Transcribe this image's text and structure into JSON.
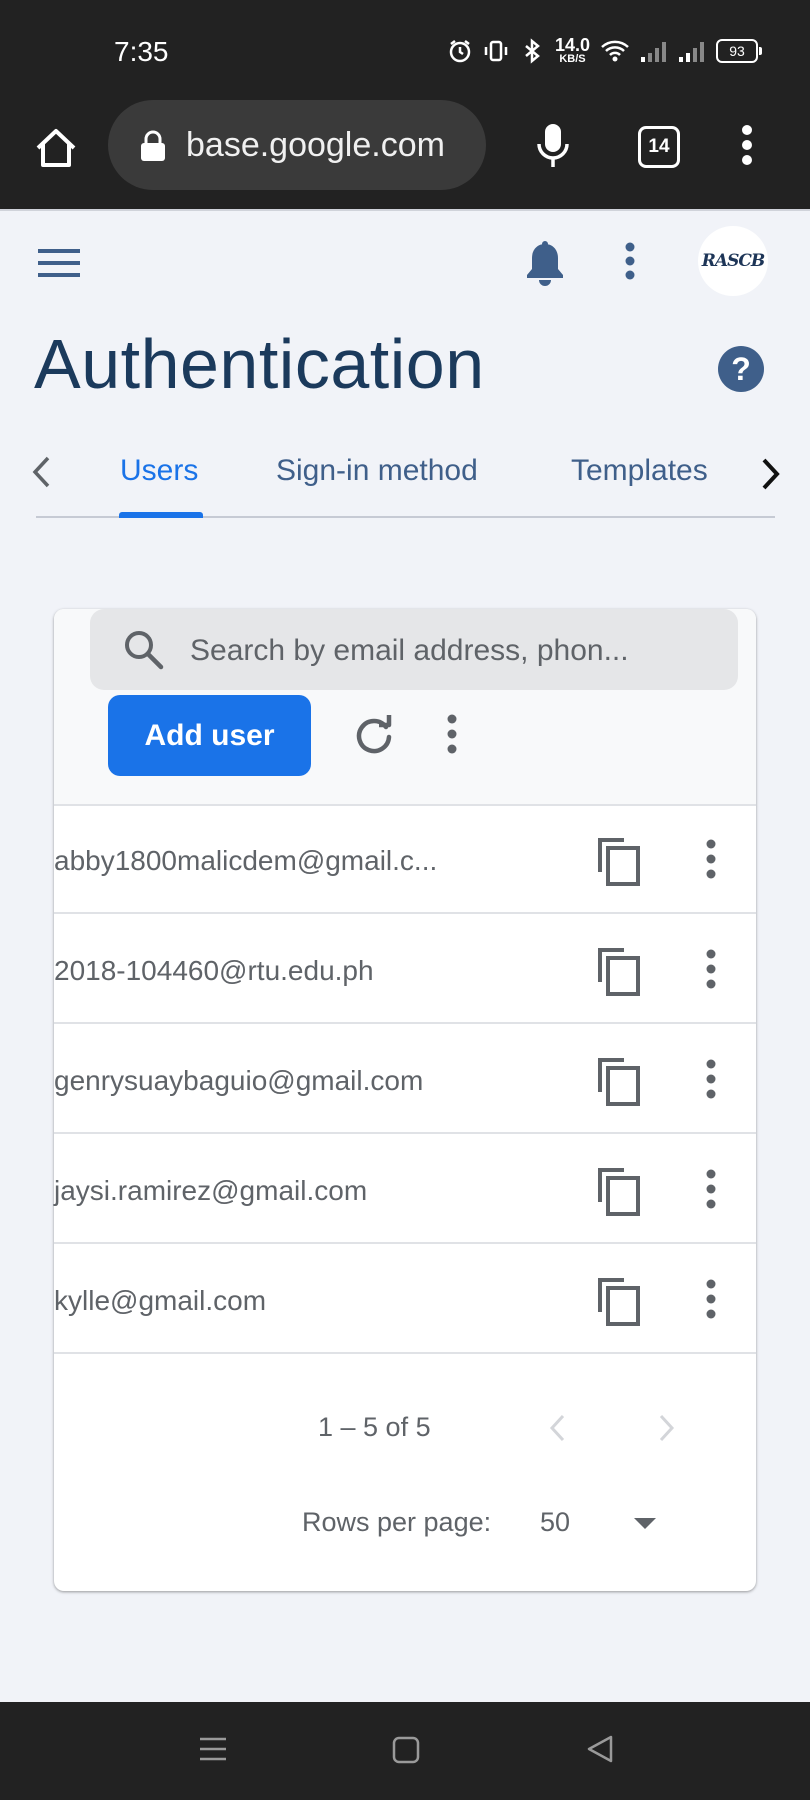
{
  "status_bar": {
    "time": "7:35",
    "net_speed": "14.0",
    "net_unit": "KB/S",
    "battery": "93"
  },
  "browser": {
    "url": "base.google.com",
    "tab_count": "14"
  },
  "page": {
    "title": "Authentication",
    "help": "?"
  },
  "tabs": [
    {
      "label": "Users",
      "active": true
    },
    {
      "label": "Sign-in method",
      "active": false
    },
    {
      "label": "Templates",
      "active": false
    }
  ],
  "users_card": {
    "search_placeholder": "Search by email address, phon...",
    "add_user_label": "Add user",
    "rows": [
      {
        "email": "abby1800malicdem@gmail.c..."
      },
      {
        "email": "2018-104460@rtu.edu.ph"
      },
      {
        "email": "genrysuaybaguio@gmail.com"
      },
      {
        "email": "jaysi.ramirez@gmail.com"
      },
      {
        "email": "kylle@gmail.com"
      }
    ],
    "pagination": {
      "range": "1 – 5 of 5",
      "rows_per_page_label": "Rows per page:",
      "rows_per_page_value": "50"
    }
  },
  "avatar_text": "RASCB",
  "colors": {
    "primary": "#1a73e8",
    "title": "#1b3a5c",
    "icon": "#3f5f8a",
    "background": "#f1f3f8",
    "system_bar": "#222222"
  }
}
